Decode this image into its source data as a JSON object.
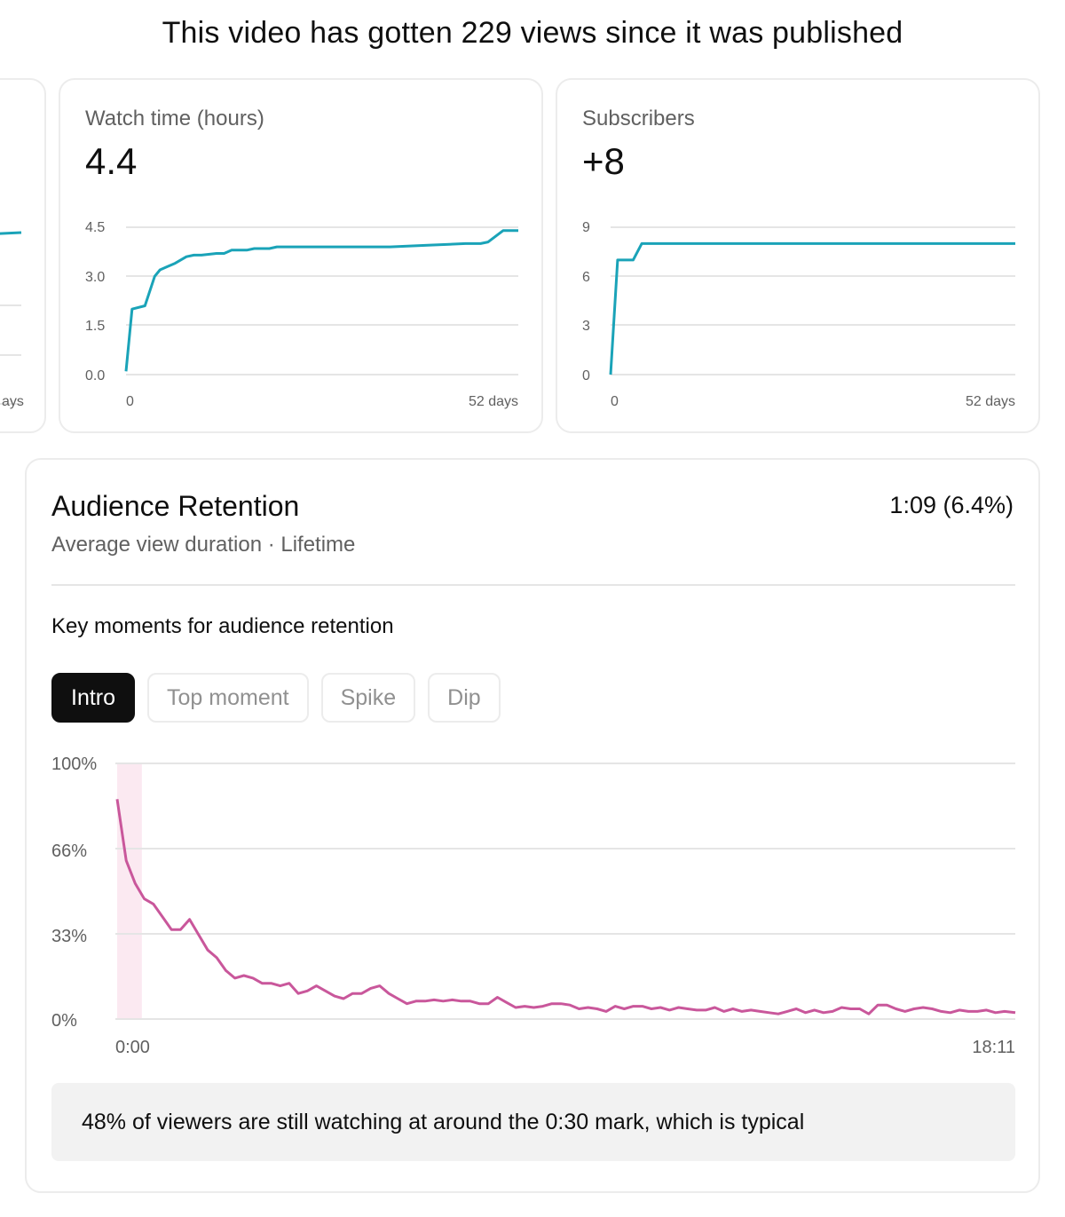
{
  "headline": "This video has gotten 229 views since it was published",
  "colors": {
    "accent_line": "#1aa3b8",
    "retention_line": "#c9579b",
    "intro_highlight": "#fbe9f1"
  },
  "left_card": {
    "x_label": "ays"
  },
  "watch_time": {
    "title": "Watch time (hours)",
    "value": "4.4",
    "y_ticks": [
      "4.5",
      "3.0",
      "1.5",
      "0.0"
    ],
    "x_start": "0",
    "x_end": "52 days"
  },
  "subscribers": {
    "title": "Subscribers",
    "value": "+8",
    "y_ticks": [
      "9",
      "6",
      "3",
      "0"
    ],
    "x_start": "0",
    "x_end": "52 days"
  },
  "retention": {
    "title": "Audience Retention",
    "value": "1:09 (6.4%)",
    "subtitle": "Average view duration · Lifetime",
    "key_moments_label": "Key moments for audience retention",
    "chips": [
      {
        "label": "Intro",
        "active": true
      },
      {
        "label": "Top moment",
        "active": false
      },
      {
        "label": "Spike",
        "active": false
      },
      {
        "label": "Dip",
        "active": false
      }
    ],
    "y_ticks": [
      "100%",
      "66%",
      "33%",
      "0%"
    ],
    "x_start": "0:00",
    "x_end": "18:11",
    "insight": "48% of viewers are still watching at around the 0:30 mark, which is typical"
  },
  "chart_data": [
    {
      "type": "line",
      "title": "Watch time (hours)",
      "xlabel": "days",
      "ylim": [
        0,
        4.5
      ],
      "xlim": [
        0,
        52
      ],
      "x": [
        0,
        0.8,
        2.5,
        3.8,
        4.5,
        5.5,
        6.5,
        8,
        9,
        10,
        12,
        13,
        14,
        16,
        17,
        19,
        20,
        22,
        25,
        28,
        30,
        35,
        40,
        45,
        47,
        48,
        50,
        52
      ],
      "series": [
        {
          "values": [
            0.1,
            2.0,
            2.1,
            3.0,
            3.2,
            3.3,
            3.4,
            3.6,
            3.65,
            3.65,
            3.7,
            3.7,
            3.8,
            3.8,
            3.85,
            3.85,
            3.9,
            3.9,
            3.9,
            3.9,
            3.9,
            3.9,
            3.95,
            4.0,
            4.0,
            4.05,
            4.4,
            4.4
          ]
        }
      ]
    },
    {
      "type": "line",
      "title": "Subscribers",
      "xlabel": "days",
      "ylim": [
        0,
        9
      ],
      "xlim": [
        0,
        52
      ],
      "x": [
        0,
        0.9,
        2.9,
        4,
        52
      ],
      "series": [
        {
          "values": [
            0,
            7,
            7,
            8,
            8
          ]
        }
      ]
    },
    {
      "type": "line",
      "title": "Audience Retention",
      "ylabel": "%",
      "ylim": [
        0,
        100
      ],
      "xlim": [
        "0:00",
        "18:11"
      ],
      "intro_range_seconds": [
        0,
        30
      ],
      "x_seconds": [
        0,
        11,
        22,
        33,
        44,
        55,
        66,
        77,
        88,
        99,
        110,
        121,
        132,
        143,
        154,
        165,
        176,
        187,
        198,
        209,
        220,
        231,
        242,
        253,
        264,
        275,
        286,
        297,
        308,
        319,
        330,
        341,
        352,
        363,
        374,
        385,
        396,
        407,
        418,
        429,
        440,
        451,
        462,
        473,
        484,
        495,
        506,
        517,
        528,
        539,
        550,
        561,
        572,
        583,
        594,
        605,
        616,
        627,
        638,
        649,
        660,
        671,
        682,
        693,
        704,
        715,
        726,
        737,
        748,
        759,
        770,
        781,
        792,
        803,
        814,
        825,
        836,
        847,
        858,
        869,
        880,
        891,
        902,
        913,
        924,
        935,
        946,
        957,
        968,
        979,
        990,
        1001,
        1012,
        1023,
        1034,
        1045,
        1056,
        1067,
        1078,
        1091
      ],
      "series": [
        {
          "values": [
            86,
            62,
            53,
            47,
            45,
            40,
            35,
            35,
            39,
            33,
            27,
            24,
            19,
            16,
            17,
            16,
            14,
            14,
            13,
            14,
            10,
            11,
            13,
            11,
            9,
            8,
            10,
            10,
            12,
            13,
            10,
            8,
            6,
            7,
            7,
            7.5,
            7,
            7.5,
            7,
            7,
            6,
            6,
            8.5,
            6.5,
            4.5,
            5,
            4.5,
            5,
            6,
            6,
            5.5,
            4,
            4.5,
            4,
            3,
            5,
            4,
            5,
            5,
            4,
            4.5,
            3.5,
            4.5,
            4,
            3.5,
            3.5,
            4.5,
            3,
            4,
            3,
            3.5,
            3,
            2.5,
            2,
            3,
            4,
            2.5,
            3.5,
            2.5,
            3,
            4.5,
            4,
            4,
            2,
            5.5,
            5.5,
            4,
            3,
            4,
            4.5,
            4,
            3,
            2.5,
            3.5,
            3,
            3,
            3.5,
            2.5,
            3,
            2.5
          ]
        }
      ]
    }
  ]
}
